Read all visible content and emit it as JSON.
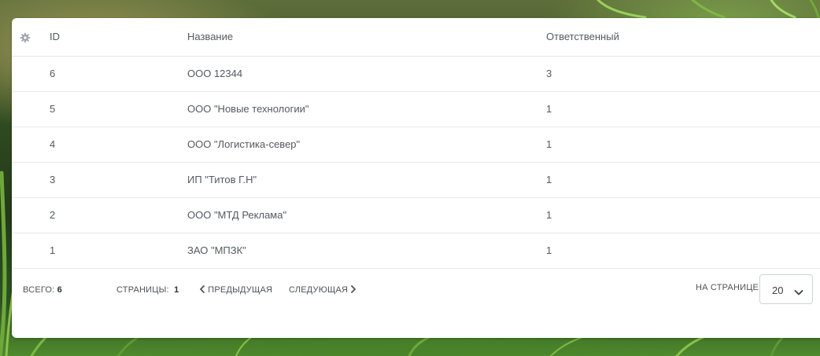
{
  "table": {
    "columns": [
      "ID",
      "Название",
      "Ответственный"
    ],
    "rows": [
      {
        "id": "6",
        "name": "ООО 12344",
        "owner": "3"
      },
      {
        "id": "5",
        "name": "ООО \"Новые технологии\"",
        "owner": "1"
      },
      {
        "id": "4",
        "name": "ООО \"Логистика-север\"",
        "owner": "1"
      },
      {
        "id": "3",
        "name": "ИП \"Титов Г.Н\"",
        "owner": "1"
      },
      {
        "id": "2",
        "name": "ООО \"МТД Реклама\"",
        "owner": "1"
      },
      {
        "id": "1",
        "name": "ЗАО \"МПЗК\"",
        "owner": "1"
      }
    ]
  },
  "footer": {
    "total_label": "ВСЕГО:",
    "total_value": "6",
    "pages_label": "СТРАНИЦЫ:",
    "pages_value": "1",
    "prev_label": "ПРЕДЫДУЩАЯ",
    "next_label": "СЛЕДУЮЩАЯ",
    "per_page_label": "НА СТРАНИЦЕ:",
    "per_page_value": "20"
  },
  "icons": {
    "settings": "gear-icon",
    "prev": "chevron-left-icon",
    "next": "chevron-right-icon",
    "dropdown": "chevron-down-icon"
  },
  "colors": {
    "header_text": "#555b61",
    "cell_text": "#545a60",
    "divider": "#e6e8ea"
  }
}
